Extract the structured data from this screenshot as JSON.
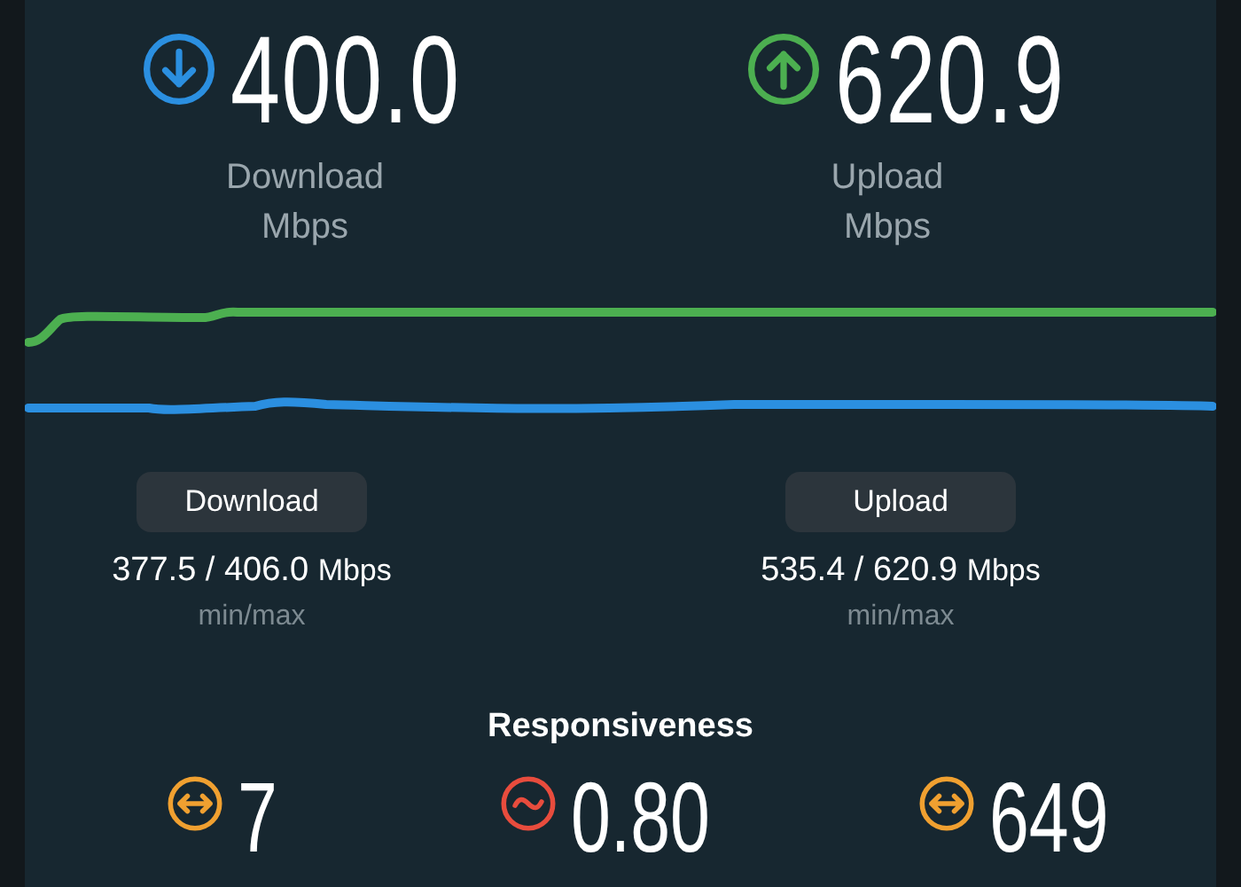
{
  "speeds": [
    {
      "kind": "download",
      "color": "#2b8fe0",
      "value": "400.0",
      "label": "Download",
      "unit": "Mbps"
    },
    {
      "kind": "upload",
      "color": "#4caf50",
      "value": "620.9",
      "label": "Upload",
      "unit": "Mbps"
    }
  ],
  "stats": [
    {
      "tab": "Download",
      "range": "377.5 / 406.0",
      "unit": "Mbps",
      "caption": "min/max"
    },
    {
      "tab": "Upload",
      "range": "535.4 / 620.9",
      "unit": "Mbps",
      "caption": "min/max"
    }
  ],
  "responsiveness": {
    "title": "Responsiveness",
    "items": [
      {
        "kind": "arrows",
        "color": "#f0a030",
        "value": "7"
      },
      {
        "kind": "wave",
        "color": "#e84c3d",
        "value": "0.80"
      },
      {
        "kind": "arrows",
        "color": "#f0a030",
        "value": "649"
      }
    ]
  }
}
